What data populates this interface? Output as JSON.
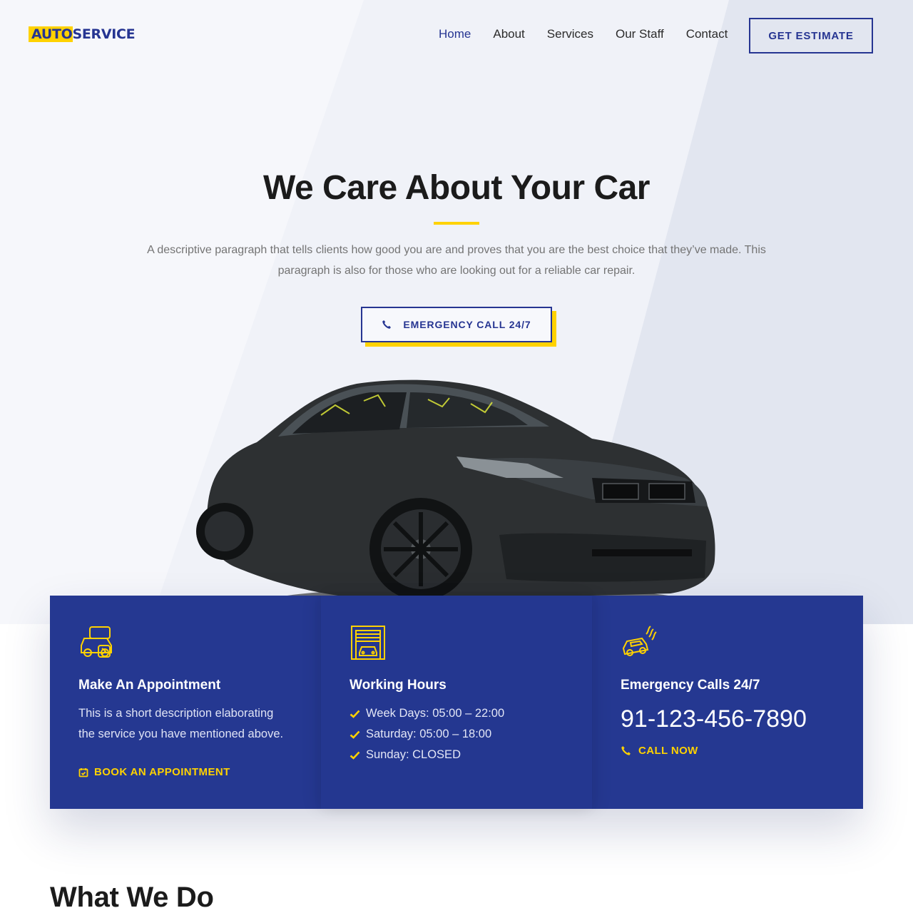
{
  "brand": {
    "logo_part1": "AUTO",
    "logo_part2": "SERVICE",
    "accent_color": "#ffd200",
    "primary_color": "#263592"
  },
  "nav": {
    "items": [
      {
        "label": "Home",
        "active": true
      },
      {
        "label": "About",
        "active": false
      },
      {
        "label": "Services",
        "active": false
      },
      {
        "label": "Our Staff",
        "active": false
      },
      {
        "label": "Contact",
        "active": false
      }
    ],
    "cta_label": "GET ESTIMATE"
  },
  "hero": {
    "title": "We Care About Your Car",
    "description": "A descriptive paragraph that tells clients how good you are and proves that you are the best choice that they’ve made. This paragraph is also for those who are looking out for a reliable car repair.",
    "button_label": "EMERGENCY CALL 24/7",
    "button_icon": "phone-icon"
  },
  "info": {
    "appointment": {
      "icon": "car-service-icon",
      "title": "Make An Appointment",
      "text": "This is a short description elaborating the service you have mentioned above.",
      "link_label": "BOOK AN APPOINTMENT",
      "link_icon": "calendar-check-icon"
    },
    "hours": {
      "icon": "garage-icon",
      "title": "Working Hours",
      "items": [
        "Week Days: 05:00 – 22:00",
        "Saturday: 05:00 – 18:00",
        "Sunday: CLOSED"
      ]
    },
    "emergency": {
      "icon": "car-crash-icon",
      "title": "Emergency Calls 24/7",
      "phone": "91-123-456-7890",
      "link_label": "CALL NOW",
      "link_icon": "phone-icon"
    }
  },
  "section": {
    "title": "What We Do"
  }
}
